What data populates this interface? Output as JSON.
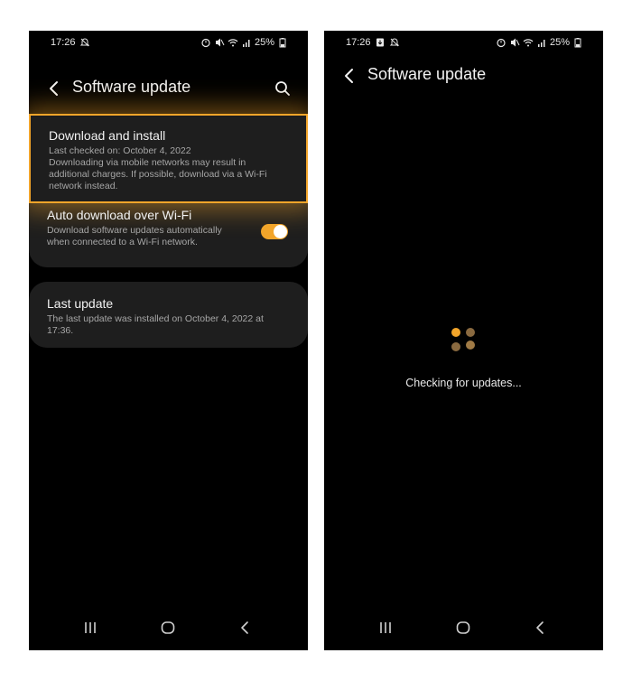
{
  "left_screen": {
    "status": {
      "time": "17:26",
      "battery": "25%"
    },
    "header": {
      "title": "Software update"
    },
    "download": {
      "title": "Download and install",
      "last_checked": "Last checked on: October 4, 2022",
      "note": "Downloading via mobile networks may result in additional charges. If possible, download via a Wi-Fi network instead."
    },
    "auto_download": {
      "title": "Auto download over Wi-Fi",
      "description": "Download software updates automatically when connected to a Wi-Fi network.",
      "enabled": true
    },
    "last_update": {
      "title": "Last update",
      "description": "The last update was installed on October 4, 2022 at 17:36."
    }
  },
  "right_screen": {
    "status": {
      "time": "17:26",
      "battery": "25%"
    },
    "header": {
      "title": "Software update"
    },
    "checking_text": "Checking for updates..."
  },
  "colors": {
    "accent": "#f2a52a",
    "background": "#000000",
    "card": "#1e1e1e",
    "highlight_border": "#f2a52a"
  },
  "icons": [
    "back-icon",
    "search-icon",
    "alarm-icon",
    "mute-icon",
    "wifi-icon",
    "signal-icon",
    "battery-icon",
    "recent-apps-icon",
    "home-icon",
    "nav-back-icon"
  ]
}
